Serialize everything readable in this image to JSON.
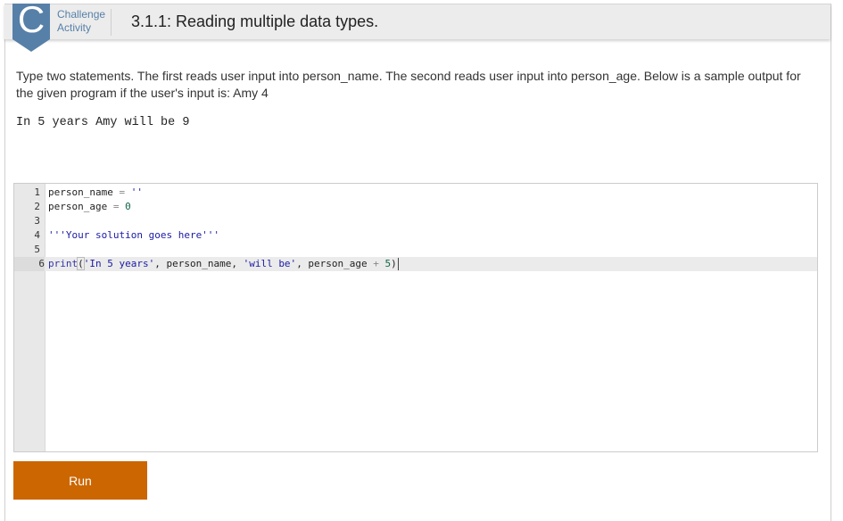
{
  "header": {
    "badge_letter": "C",
    "activity_type_line1": "Challenge",
    "activity_type_line2": "Activity",
    "title": "3.1.1: Reading multiple data types."
  },
  "instructions": "Type two statements. The first reads user input into person_name. The second reads user input into person_age. Below is a sample output for the given program if the user's input is: Amy 4",
  "sample_output": "In 5 years Amy will be 9",
  "editor": {
    "active_line": 6,
    "lines": [
      {
        "num": "1",
        "tokens": [
          {
            "t": "person_name ",
            "c": ""
          },
          {
            "t": "=",
            "c": "op"
          },
          {
            "t": " ",
            "c": ""
          },
          {
            "t": "''",
            "c": "str"
          }
        ]
      },
      {
        "num": "2",
        "tokens": [
          {
            "t": "person_age ",
            "c": ""
          },
          {
            "t": "=",
            "c": "op"
          },
          {
            "t": " ",
            "c": ""
          },
          {
            "t": "0",
            "c": "num"
          }
        ]
      },
      {
        "num": "3",
        "tokens": []
      },
      {
        "num": "4",
        "tokens": [
          {
            "t": "'''Your solution goes here'''",
            "c": "str"
          }
        ]
      },
      {
        "num": "5",
        "tokens": []
      },
      {
        "num": "6",
        "tokens": [
          {
            "t": "print",
            "c": "kw"
          },
          {
            "t": "(",
            "c": "bracket"
          },
          {
            "t": "'In 5 years'",
            "c": "str"
          },
          {
            "t": ", person_name, ",
            "c": ""
          },
          {
            "t": "'will be'",
            "c": "str"
          },
          {
            "t": ", person_age ",
            "c": ""
          },
          {
            "t": "+",
            "c": "op"
          },
          {
            "t": " ",
            "c": ""
          },
          {
            "t": "5",
            "c": "num"
          },
          {
            "t": ")",
            "c": ""
          }
        ]
      }
    ]
  },
  "run_button": {
    "label": "Run"
  },
  "colors": {
    "badge": "#5780a8",
    "run_button": "#cc6600",
    "header_bg": "#ececec"
  }
}
